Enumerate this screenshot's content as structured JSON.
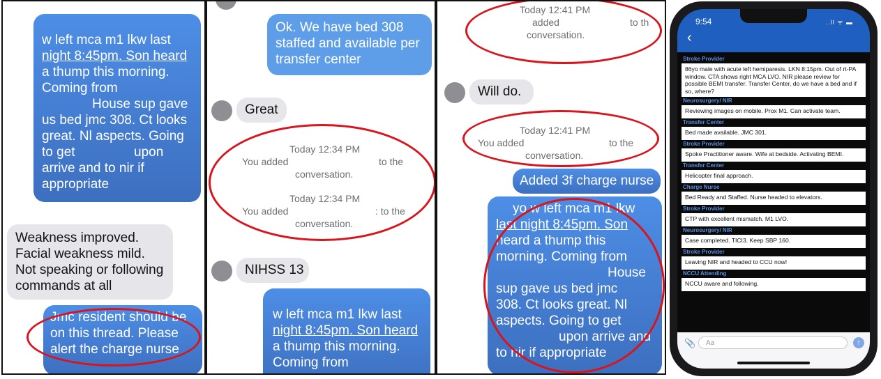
{
  "panel1": {
    "bubble_top": [
      "w left mca m1 lkw last",
      "night 8:45pm. Son heard",
      "a thump this morning.",
      "Coming from",
      "House sup gave",
      "us bed jmc 308. Ct looks",
      "great. Nl aspects. Going",
      "to get                upon",
      "arrive and to nir if",
      "appropriate"
    ],
    "bubble_gray": [
      "Weakness improved.",
      "Facial weakness mild.",
      "Not speaking or following",
      "commands at all"
    ],
    "bubble_bottom": [
      "Jmc resident should be",
      "on this thread. Please",
      "alert the charge nurse"
    ]
  },
  "panel2": {
    "bubble_top": [
      "Ok. We have bed 308",
      "staffed and available per",
      "transfer center"
    ],
    "great": "Great",
    "sys1_time": "Today 12:34 PM",
    "sys1_added": "You added",
    "sys1_to": "to the",
    "sys1_conv": "conversation.",
    "sys2_time": "Today 12:34 PM",
    "sys2_added": "You added",
    "sys2_to": ": to the",
    "sys2_conv": "conversation.",
    "nihss": "NIHSS 13",
    "bubble_bottom": [
      "w left mca m1 lkw last",
      "night 8:45pm. Son heard",
      "a thump this morning.",
      "Coming from"
    ]
  },
  "panel3": {
    "sys1_time": "Today 12:41 PM",
    "sys1_added": "added",
    "sys1_to": "to th",
    "sys1_conv": "conversation.",
    "will_do": "Will do.",
    "sys2_time": "Today 12:41 PM",
    "sys2_added": "You added",
    "sys2_to": "to the",
    "sys2_conv": "conversation.",
    "added_charge": "Added 3f charge nurse",
    "bubble_big": [
      "yo w left mca m1 lkw",
      "last night 8:45pm. Son",
      "heard a thump this",
      "morning. Coming from",
      "House",
      "sup gave us bed jmc",
      "308. Ct looks great. Nl",
      "aspects. Going to get",
      "upon arrive and",
      "to nir if appropriate"
    ]
  },
  "phone": {
    "time": "9:54",
    "signal": "..ll ᯤ ▬",
    "back_icon": "‹",
    "input_placeholder": "Aa",
    "send_icon": "↑",
    "clip_icon": "📎",
    "messages": [
      {
        "sender": "Stroke Provider",
        "text": "86yo male with acute left hemiparesis. LKN 8:15pm. Out of rt-PA window. CTA shows right MCA LVO. NIR please review for possible BEMI transfer.  Transfer Center, do we have a bed and if so, where?"
      },
      {
        "sender": "Neurosurgery/ NIR",
        "text": "Reviewing images on mobile. Prox M1. Can activate team."
      },
      {
        "sender": "Transfer Center",
        "text": "Bed made available. JMC 301."
      },
      {
        "sender": "Stroke Provider",
        "text": "Spoke Practitioner aware. Wife at bedside. Activating BEMI."
      },
      {
        "sender": "Transfer Center",
        "text": "Helicopter final approach."
      },
      {
        "sender": "Charge Nurse",
        "text": "Bed Ready and Staffed. Nurse headed to elevators."
      },
      {
        "sender": "Stroke Provider",
        "text": "CTP with excellent mismatch. M1 LVO."
      },
      {
        "sender": "Neurosurgery/ NIR",
        "text": "Case completed. TICI3. Keep SBP 160."
      },
      {
        "sender": "Stroke Provider",
        "text": "Leaving NIR and headed to CCU now!"
      },
      {
        "sender": "NCCU Attending",
        "text": "NCCU aware and following."
      }
    ]
  },
  "colors": {
    "bubble_blue": "#4d8ee6",
    "bubble_gray": "#e6e6ea",
    "ring_red": "#d9141c",
    "header_blue": "#1f5fbf"
  }
}
